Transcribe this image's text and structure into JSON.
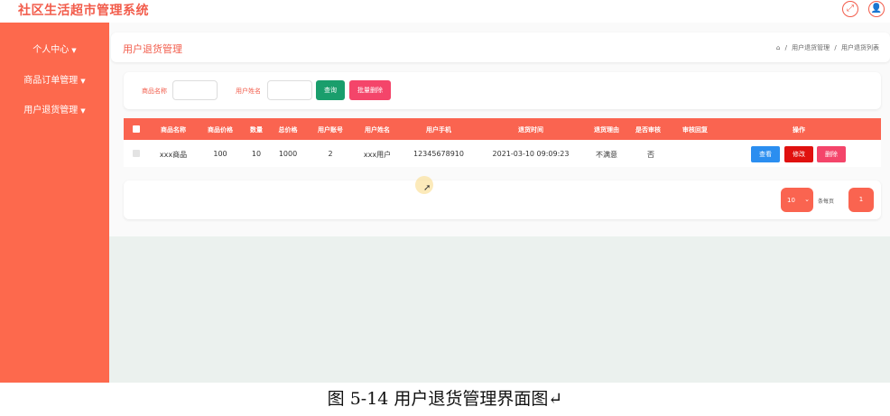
{
  "app": {
    "title": "社区生活超市管理系统"
  },
  "top_icons": {
    "fullscreen": "expand-icon",
    "user": "user-icon"
  },
  "sidebar": {
    "items": [
      {
        "label": "个人中心"
      },
      {
        "label": "商品订单管理"
      },
      {
        "label": "用户退货管理"
      }
    ]
  },
  "page": {
    "title": "用户退货管理",
    "breadcrumb": [
      "用户退货管理",
      "用户退货列表"
    ]
  },
  "search": {
    "product_label": "商品名称",
    "user_label": "用户姓名",
    "query_button": "查询",
    "batch_delete_button": "批量删除"
  },
  "table": {
    "headers": [
      "商品名称",
      "商品价格",
      "数量",
      "总价格",
      "用户账号",
      "用户姓名",
      "用户手机",
      "退货时间",
      "退货理由",
      "是否审核",
      "审核回复",
      "操作"
    ],
    "rows": [
      {
        "product": "xxx商品",
        "price": "100",
        "qty": "10",
        "total": "1000",
        "account": "2",
        "name": "xxx用户",
        "phone": "12345678910",
        "time": "2021-03-10 09:09:23",
        "reason": "不满意",
        "audited": "否",
        "reply": ""
      }
    ],
    "actions": {
      "view": "查看",
      "edit": "修改",
      "delete": "删除"
    }
  },
  "pagination": {
    "page_size": "10",
    "per_page_label": "条每页",
    "current_page": "1"
  },
  "caption": "图 5-14 用户退货管理界面图↵",
  "colors": {
    "accent": "#fa6450",
    "sidebar": "#fd694d",
    "query": "#1a9e6c",
    "view": "#2b8ef0",
    "edit": "#e0110f",
    "delete": "#f4456a"
  }
}
